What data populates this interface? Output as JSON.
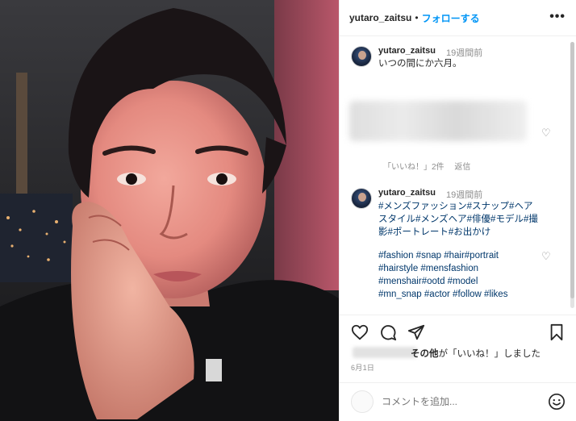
{
  "header": {
    "username": "yutaro_zaitsu",
    "separator": "•",
    "follow_label": "フォローする",
    "more_label": "•••"
  },
  "caption": {
    "username": "yutaro_zaitsu",
    "time": "19週間前",
    "text": "いつの間にか六月。"
  },
  "blurred_comment": {
    "likes_label": "「いいね！」2件",
    "reply_label": "返信"
  },
  "tags_comment": {
    "username": "yutaro_zaitsu",
    "time": "19週間前",
    "jp_tags": "#メンズファッション#スナップ#ヘアスタイル#メンズヘア#俳優#モデル#撮影#ポートレート#お出かけ",
    "en_tags": "#fashion #snap #hair#portrait #hairstyle #mensfashion #menshair#ootd #model #mn_snap #actor #follow #likes"
  },
  "likes": {
    "others_bold": "その他",
    "suffix": "が「いいね！」しました"
  },
  "date": "6月1日",
  "comment_input": {
    "placeholder": "コメントを追加..."
  },
  "icons": {
    "like": "heart-icon",
    "comment": "comment-icon",
    "share": "paper-plane-icon",
    "save": "bookmark-icon",
    "emoji": "smiley-icon"
  }
}
